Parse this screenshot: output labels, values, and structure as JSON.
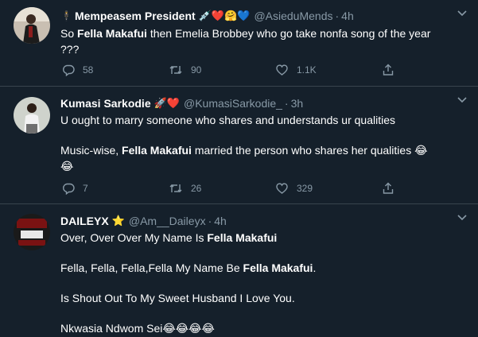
{
  "tweets": [
    {
      "name": "Mempeasem President",
      "emojis": "💉❤️🤗💙",
      "handle": "@AsieduMends",
      "time": "4h",
      "lines": [
        {
          "pre": "So ",
          "bold": "Fella Makafui",
          "post": " then Emelia Brobbey who go take nonfa song of the year"
        },
        {
          "pre": "???",
          "bold": "",
          "post": ""
        }
      ],
      "replies": "58",
      "retweets": "90",
      "likes": "1.1K"
    },
    {
      "name": "Kumasi Sarkodie",
      "emojis": "🚀❤️",
      "handle": "@KumasiSarkodie_",
      "time": "3h",
      "lines": [
        {
          "pre": "U ought to marry someone who shares and understands ur qualities",
          "bold": "",
          "post": ""
        },
        {
          "pre": "Music-wise, ",
          "bold": "Fella Makafui",
          "post": " married the person who shares her qualities 😂"
        },
        {
          "pre": "😂",
          "bold": "",
          "post": ""
        }
      ],
      "replies": "7",
      "retweets": "26",
      "likes": "329"
    },
    {
      "name": "DAILEYX",
      "emojis": "⭐",
      "handle": "@Am__Daileyx",
      "time": "4h",
      "lines": [
        {
          "pre": "Over, Over Over My Name Is ",
          "bold": "Fella Makafui",
          "post": ""
        },
        {
          "pre": "Fella, Fella, Fella,Fella My Name Be ",
          "bold": "Fella Makafui",
          "post": "."
        },
        {
          "pre": "Is Shout Out To My Sweet Husband I Love You.",
          "bold": "",
          "post": ""
        },
        {
          "pre": "Nkwasia Ndwom Sei😂😂😂😂",
          "bold": "",
          "post": ""
        }
      ]
    }
  ],
  "colors": {
    "background": "#15202b",
    "secondary_text": "#8899a6",
    "divider": "#38444d"
  }
}
